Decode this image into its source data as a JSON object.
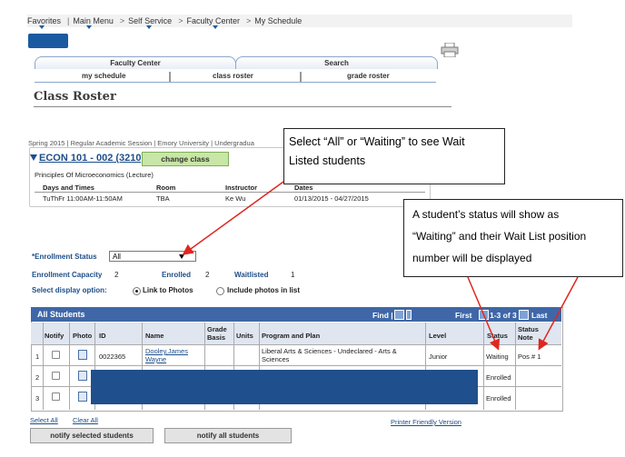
{
  "breadcrumb": {
    "items": [
      "Favorites",
      "Main Menu",
      "Self Service",
      "Faculty Center",
      "My Schedule"
    ],
    "separator": ">"
  },
  "tabs": {
    "faculty_center": "Faculty Center",
    "search": "Search"
  },
  "subtabs": {
    "my_schedule": "my schedule",
    "class_roster": "class roster",
    "grade_roster": "grade roster"
  },
  "page_title": "Class Roster",
  "session_line": "Spring 2015 | Regular Academic Session | Emory University | Undergradua",
  "class": {
    "title": "ECON 101 - 002 (3210)",
    "change_button": "change class",
    "description": "Principles Of Microeconomics (Lecture)",
    "headers": {
      "days": "Days and Times",
      "room": "Room",
      "instructor": "Instructor",
      "dates": "Dates"
    },
    "values": {
      "days": "TuThFr 11:00AM-11:50AM",
      "room": "TBA",
      "instructor": "Ke Wu",
      "dates": "01/13/2015 - 04/27/2015"
    }
  },
  "callouts": {
    "one": [
      "Select “All” or “Waiting” to see Wait",
      "Listed students"
    ],
    "two": [
      "A student’s status will show as",
      "“Waiting” and their Wait List position",
      "number will be displayed"
    ]
  },
  "enrollment": {
    "status_label": "*Enrollment Status",
    "status_value": "All",
    "capacity_label": "Enrollment Capacity",
    "capacity_value": "2",
    "enrolled_label": "Enrolled",
    "enrolled_value": "2",
    "waitlisted_label": "Waitlisted",
    "waitlisted_value": "1",
    "display_label": "Select display option:",
    "opt_link": "Link to Photos",
    "opt_include": "Include photos in list"
  },
  "grid": {
    "title": "All Students",
    "find": "Find |",
    "pager": "First",
    "range": "1-3 of 3",
    "last": "Last",
    "columns": [
      "Notify",
      "Photo",
      "ID",
      "Name",
      "Grade Basis",
      "Units",
      "Program and Plan",
      "Level",
      "Status",
      "Status Note"
    ],
    "rows": [
      {
        "num": "1",
        "id": "0022365",
        "name": "Dooley,James Wayne",
        "program": "Liberal Arts & Sciences - Undeclared - Arts & Sciences",
        "level": "Junior",
        "status": "Waiting",
        "note": "Pos # 1"
      },
      {
        "num": "2",
        "status": "Enrolled"
      },
      {
        "num": "3",
        "status": "Enrolled"
      }
    ]
  },
  "footer": {
    "select_all": "Select All",
    "clear_all": "Clear All",
    "printer": "Printer Friendly Version",
    "notify_selected": "notify selected students",
    "notify_all": "notify all students"
  }
}
